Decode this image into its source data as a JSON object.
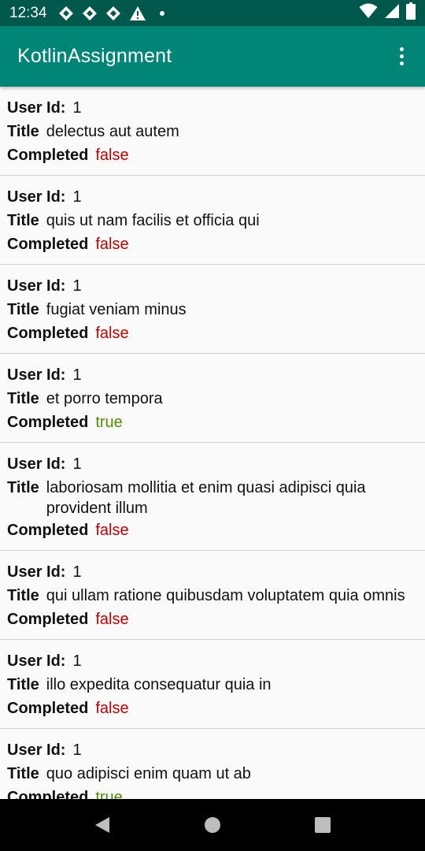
{
  "status_bar": {
    "time": "12:34",
    "notification_icons": [
      "diamond-icon",
      "diamond-icon",
      "diamond-icon",
      "warning-icon",
      "dot-icon"
    ],
    "right_icons": [
      "wifi-icon",
      "signal-icon",
      "battery-icon"
    ]
  },
  "app_bar": {
    "title": "KotlinAssignment"
  },
  "labels": {
    "user_id": "User Id:",
    "title": "Title",
    "completed": "Completed"
  },
  "todos": [
    {
      "user_id": "1",
      "title": "delectus aut autem",
      "completed": "false"
    },
    {
      "user_id": "1",
      "title": "quis ut nam facilis et officia qui",
      "completed": "false"
    },
    {
      "user_id": "1",
      "title": "fugiat veniam minus",
      "completed": "false"
    },
    {
      "user_id": "1",
      "title": "et porro tempora",
      "completed": "true"
    },
    {
      "user_id": "1",
      "title": "laboriosam mollitia et enim quasi adipisci quia provident illum",
      "completed": "false"
    },
    {
      "user_id": "1",
      "title": "qui ullam ratione quibusdam voluptatem quia omnis",
      "completed": "false"
    },
    {
      "user_id": "1",
      "title": "illo expedita consequatur quia in",
      "completed": "false"
    },
    {
      "user_id": "1",
      "title": "quo adipisci enim quam ut ab",
      "completed": "true"
    }
  ],
  "colors": {
    "status_bar": "#00574b",
    "app_bar": "#008577",
    "completed_true": "#4e8f00",
    "completed_false": "#c40000"
  }
}
